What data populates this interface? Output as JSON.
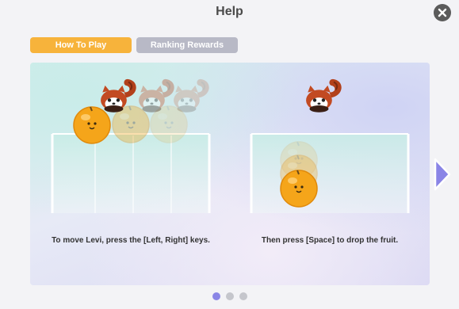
{
  "header": {
    "title": "Help"
  },
  "tabs": [
    {
      "label": "How To Play",
      "active": true
    },
    {
      "label": "Ranking Rewards",
      "active": false
    }
  ],
  "steps": [
    {
      "caption": "To move Levi, press the [Left, Right] keys."
    },
    {
      "caption": "Then press [Space] to drop the fruit."
    }
  ],
  "pagination": {
    "total": 3,
    "current": 1
  },
  "colors": {
    "tab_active": "#f7b33b",
    "tab_inactive": "#b8b9c6",
    "accent": "#8a85e6",
    "fruit": "#f5a51a",
    "panda": "#c24a22"
  },
  "icons": {
    "close": "close-icon",
    "next": "arrow-right-icon"
  }
}
